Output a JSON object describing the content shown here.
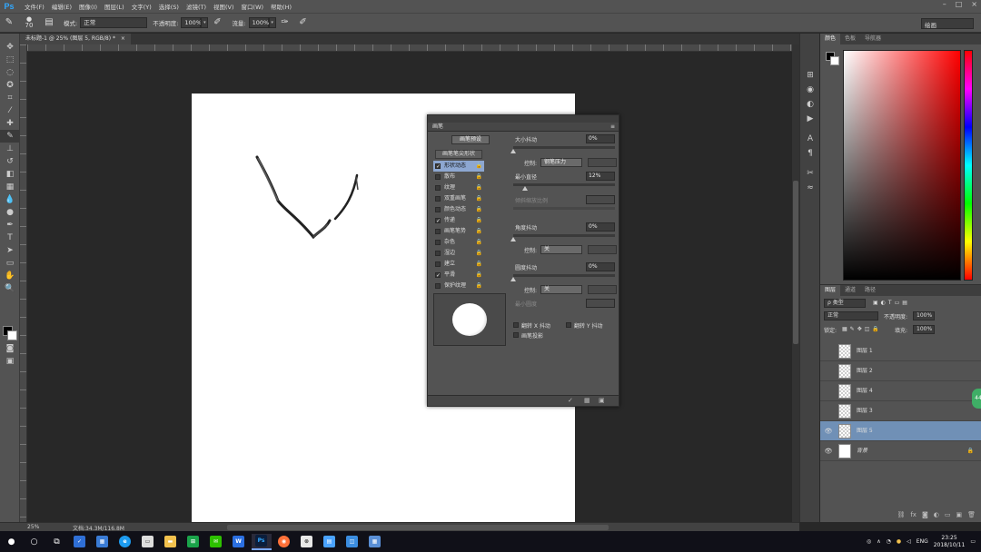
{
  "menubar": {
    "logo": "Ps",
    "items": [
      "文件(F)",
      "编辑(E)",
      "图像(I)",
      "图层(L)",
      "文字(Y)",
      "选择(S)",
      "滤镜(T)",
      "视图(V)",
      "窗口(W)",
      "帮助(H)"
    ],
    "window_controls": [
      "–",
      "□",
      "×"
    ]
  },
  "options_bar": {
    "brush_size": "70",
    "mode_label": "模式:",
    "mode_value": "正常",
    "opacity_label": "不透明度:",
    "opacity_value": "100%",
    "flow_label": "流量:",
    "flow_value": "100%",
    "workspace": "绘画"
  },
  "document_tab": {
    "title": "未标题-1 @ 25% (图层 5, RGB/8) *",
    "close": "×"
  },
  "toolbar": {
    "tools": [
      "move-icon",
      "marquee-icon",
      "lasso-icon",
      "quick-select-icon",
      "crop-icon",
      "eyedropper-icon",
      "healing-icon",
      "brush-icon",
      "stamp-icon",
      "history-brush-icon",
      "eraser-icon",
      "gradient-icon",
      "blur-icon",
      "dodge-icon",
      "pen-icon",
      "type-icon",
      "path-select-icon",
      "shape-icon",
      "hand-icon",
      "zoom-icon"
    ],
    "active_index": 7,
    "foreground": "#000000",
    "background": "#ffffff"
  },
  "brush_panel": {
    "tab": "画笔",
    "presets_button": "画笔预设",
    "tip_shape": "画笔笔尖形状",
    "options": [
      {
        "label": "形状动态",
        "checked": true,
        "active": true
      },
      {
        "label": "散布",
        "checked": false,
        "active": false
      },
      {
        "label": "纹理",
        "checked": false,
        "active": false
      },
      {
        "label": "双重画笔",
        "checked": false,
        "active": false
      },
      {
        "label": "颜色动态",
        "checked": false,
        "active": false
      },
      {
        "label": "传递",
        "checked": true,
        "active": false
      },
      {
        "label": "画笔笔势",
        "checked": false,
        "active": false
      },
      {
        "label": "杂色",
        "checked": false,
        "active": false
      },
      {
        "label": "湿边",
        "checked": false,
        "active": false
      },
      {
        "label": "建立",
        "checked": false,
        "active": false
      },
      {
        "label": "平滑",
        "checked": true,
        "active": false
      },
      {
        "label": "保护纹理",
        "checked": false,
        "active": false
      }
    ],
    "lock_glyph": "🔒",
    "check_glyph": "✓",
    "size_jitter_label": "大小抖动",
    "size_jitter_value": "0%",
    "control_label": "控制:",
    "control_size_value": "钢笔压力",
    "min_diameter_label": "最小直径",
    "min_diameter_value": "12%",
    "tilt_scale_label": "倾斜缩放比例",
    "angle_jitter_label": "角度抖动",
    "angle_jitter_value": "0%",
    "control_angle_value": "关",
    "roundness_jitter_label": "圆度抖动",
    "roundness_jitter_value": "0%",
    "control_round_value": "关",
    "min_roundness_label": "最小圆度",
    "flip_x_label": "翻转 X 抖动",
    "flip_y_label": "翻转 Y 抖动",
    "brush_projection_label": "画笔投影"
  },
  "right_panels": {
    "top_tabs": [
      "颜色",
      "色板",
      "导航器"
    ],
    "layer_tabs": [
      "图层",
      "通道",
      "路径"
    ],
    "kind_label": "ρ 类型",
    "blend_mode": "正常",
    "opacity_label": "不透明度:",
    "opacity_value": "100%",
    "lock_label": "锁定:",
    "fill_label": "填充:",
    "fill_value": "100%",
    "layers": [
      {
        "name": "图层 1",
        "visible": false,
        "selected": false,
        "solid": false,
        "italic": false,
        "locked": false
      },
      {
        "name": "图层 2",
        "visible": false,
        "selected": false,
        "solid": false,
        "italic": false,
        "locked": false
      },
      {
        "name": "图层 4",
        "visible": false,
        "selected": false,
        "solid": false,
        "italic": false,
        "locked": false
      },
      {
        "name": "图层 3",
        "visible": false,
        "selected": false,
        "solid": false,
        "italic": false,
        "locked": false
      },
      {
        "name": "图层 5",
        "visible": true,
        "selected": true,
        "solid": false,
        "italic": false,
        "locked": false
      },
      {
        "name": "背景",
        "visible": true,
        "selected": false,
        "solid": true,
        "italic": true,
        "locked": true
      }
    ],
    "eye_glyph": "👁",
    "lock_glyph": "🔒",
    "green_tab": "44"
  },
  "statusbar": {
    "zoom": "25%",
    "doc_info": "文档:34.3M/116.8M"
  },
  "taskbar": {
    "ime": "ENG",
    "time": "23:25",
    "date": "2018/10/11"
  }
}
